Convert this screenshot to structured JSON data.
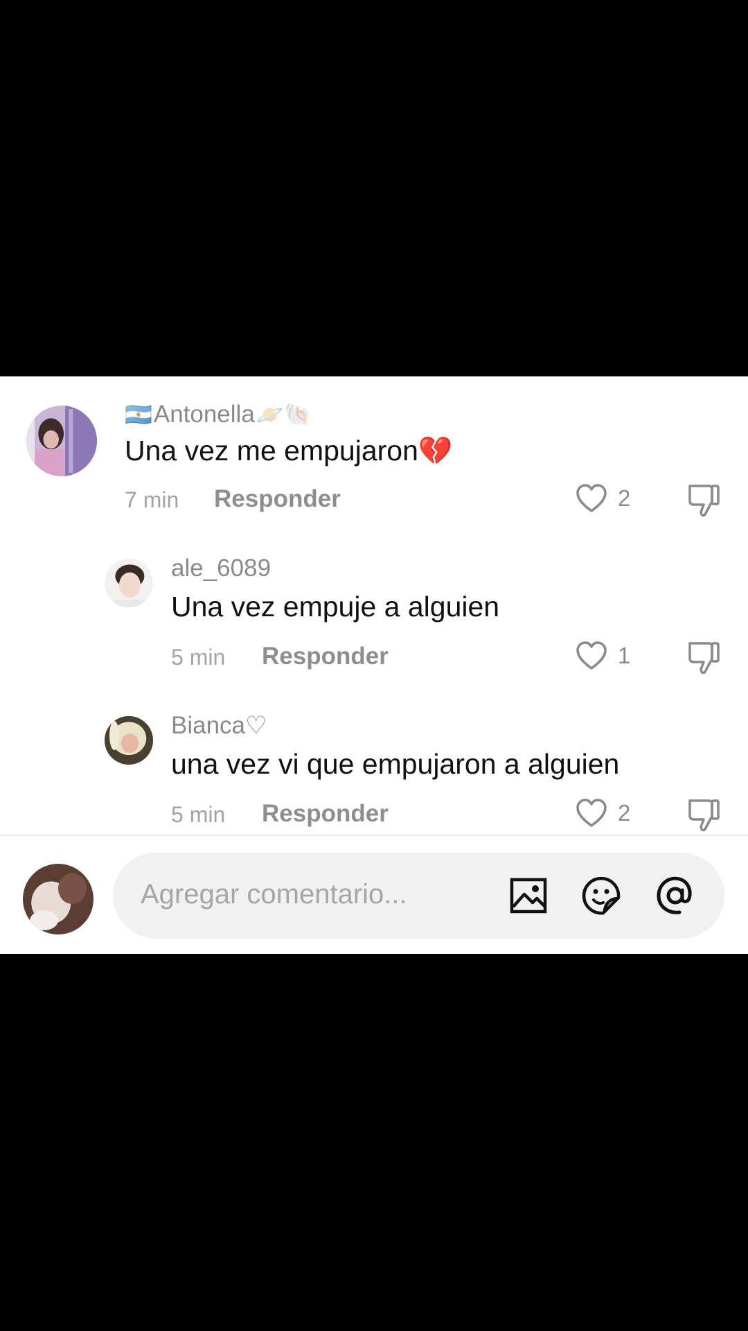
{
  "comments": [
    {
      "username": "Antonella",
      "username_prefix_emoji": "🇦🇷",
      "username_suffix_emoji": "🪐🐚",
      "text": "Una vez me empujaron",
      "text_emoji": "💔",
      "time": "7 min",
      "reply_label": "Responder",
      "likes": "2"
    },
    {
      "username": "ale_6089",
      "text": "Una vez empuje a alguien",
      "time": "5 min",
      "reply_label": "Responder",
      "likes": "1"
    },
    {
      "username": "Bianca♡",
      "text": "una vez vi que empujaron a alguien",
      "time": "5 min",
      "reply_label": "Responder",
      "likes": "2"
    }
  ],
  "input": {
    "placeholder": "Agregar comentario..."
  },
  "colors": {
    "background": "#000000",
    "panel": "#ffffff",
    "username": "#8a8a8a",
    "text": "#111111",
    "meta": "#a3a3a3",
    "input_bg": "#f1f1f2"
  },
  "icons": {
    "like": "heart-outline-icon",
    "dislike": "thumbs-down-icon",
    "image": "image-icon",
    "sticker": "emoji-sticker-icon",
    "mention": "at-sign-icon"
  }
}
